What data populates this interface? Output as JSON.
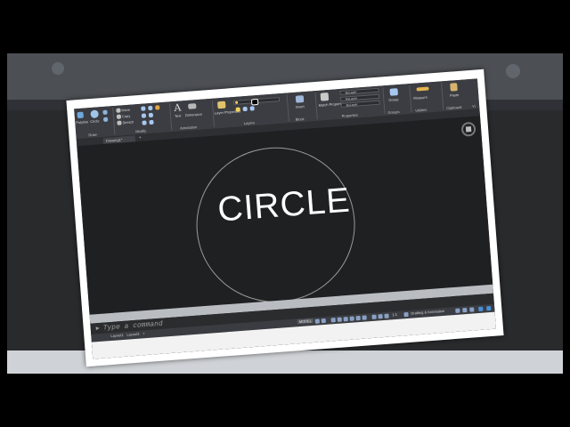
{
  "ribbon": {
    "draw": {
      "polyline": "Polyline",
      "circle": "Circle",
      "label": "Draw"
    },
    "modify": {
      "move": "Move",
      "copy": "Copy",
      "stretch": "Stretch",
      "label": "Modify"
    },
    "annotation": {
      "text": "Text",
      "dimension": "Dimension",
      "label": "Annotation"
    },
    "layers": {
      "layer_properties": "Layer Properties",
      "label": "Layers"
    },
    "block": {
      "insert": "Insert",
      "label": "Block"
    },
    "properties": {
      "match": "Match Properties",
      "bylayer1": "ByLayer",
      "bylayer2": "ByLayer",
      "bylayer3": "ByLayer",
      "label": "Properties"
    },
    "groups": {
      "group": "Group",
      "label": "Groups"
    },
    "utilities": {
      "measure": "Measure",
      "label": "Utilities"
    },
    "clipboard": {
      "paste": "Paste",
      "label": "Clipboard"
    },
    "view": {
      "label": "Vi"
    }
  },
  "tabs": {
    "drawing": "Drawing1*",
    "add": "+"
  },
  "canvas": {
    "text": "CIRCLE"
  },
  "command": {
    "placeholder": "Type a command"
  },
  "status": {
    "layout1": "Layout1",
    "layout2": "Layout2",
    "add": "+",
    "model": "MODEL",
    "scale": "1:1",
    "workspace": "Drafting & Annotation"
  },
  "colors": {
    "accent": "#4a90d9",
    "canvas": "#1f2022",
    "ribbon": "#3b3d42"
  }
}
